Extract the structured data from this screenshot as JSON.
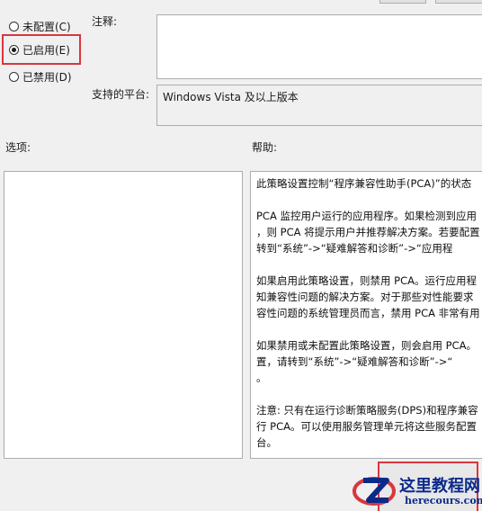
{
  "state_options": [
    {
      "label": "未配置(C)",
      "checked": false
    },
    {
      "label": "已启用(E)",
      "checked": true
    },
    {
      "label": "已禁用(D)",
      "checked": false
    }
  ],
  "comment": {
    "label": "注释:",
    "value": ""
  },
  "platform": {
    "label": "支持的平台:",
    "value": "Windows Vista 及以上版本"
  },
  "options": {
    "label": "选项:"
  },
  "help": {
    "label": "帮助:",
    "paragraphs": [
      [
        "此策略设置控制“程序兼容性助手(PCA)”的状态"
      ],
      [
        "PCA 监控用户运行的应用程序。如果检测到应用",
        "，则 PCA 将提示用户并推荐解决方案。若要配置",
        "转到“系统”->“疑难解答和诊断”->“应用程"
      ],
      [
        "如果启用此策略设置，则禁用 PCA。运行应用程",
        "知兼容性问题的解决方案。对于那些对性能要求",
        "容性问题的系统管理员而言，禁用 PCA 非常有用"
      ],
      [
        "如果禁用或未配置此策略设置，则会启用 PCA。",
        "置，请转到“系统”->“疑难解答和诊断”->“",
        "。"
      ],
      [
        "注意: 只有在运行诊断策略服务(DPS)和程序兼容",
        "行 PCA。可以使用服务管理单元将这些服务配置",
        "台。"
      ]
    ]
  },
  "watermark": {
    "title": "这里教程网",
    "url": "herecours.com",
    "colors": {
      "red": "#d9363e",
      "blue": "#0a2a8a"
    }
  }
}
